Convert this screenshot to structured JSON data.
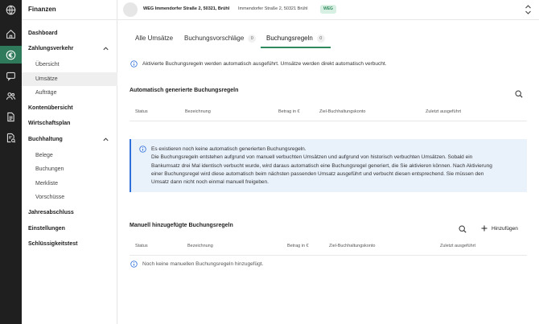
{
  "sidebar": {
    "title": "Finanzen",
    "items": [
      {
        "label": "Dashboard"
      },
      {
        "label": "Zahlungsverkehr"
      },
      {
        "label": "Übersicht"
      },
      {
        "label": "Umsätze"
      },
      {
        "label": "Aufträge"
      },
      {
        "label": "Kontenübersicht"
      },
      {
        "label": "Wirtschaftsplan"
      },
      {
        "label": "Buchhaltung"
      },
      {
        "label": "Belege"
      },
      {
        "label": "Buchungen"
      },
      {
        "label": "Merkliste"
      },
      {
        "label": "Vorschüsse"
      },
      {
        "label": "Jahresabschluss"
      },
      {
        "label": "Einstellungen"
      },
      {
        "label": "Schlüssigkeitstest"
      }
    ]
  },
  "rail_icons": [
    "globe-icon",
    "home-icon",
    "euro-icon",
    "chat-icon",
    "people-icon",
    "document-icon",
    "document-list-icon"
  ],
  "topbar": {
    "property_name": "WEG Immendorfer Straße 2, 50321, Brühl",
    "property_address": "Immendorfer Straße 2, 50321 Brühl",
    "badge": "WEG"
  },
  "tabs": [
    {
      "label": "Alle Umsätze",
      "count": ""
    },
    {
      "label": "Buchungsvorschläge",
      "count": "0"
    },
    {
      "label": "Buchungsregeln",
      "count": "0"
    }
  ],
  "notice": "Aktivierte Buchungsregeln werden automatisch ausgeführt. Umsätze werden direkt automatisch verbucht.",
  "auto_section": {
    "title": "Automatisch generierte Buchungsregeln",
    "columns": [
      "Status",
      "Bezeichnung",
      "Betrag in €",
      "Ziel-Buchhaltungskonto",
      "Zuletzt ausgeführt"
    ],
    "info_lines": [
      "Es existieren noch keine automatisch generierten Buchungsregeln.",
      "Die Buchungsregeln entstehen aufgrund von manuell verbuchten Umsätzen und aufgrund von historisch verbuchten Umsätzen.  Sobald ein",
      "Bankumsatz drei Mal identisch verbucht wurde, wird daraus automatisch eine Buchungsregel generiert, die Sie aktivieren können. Nach Aktivierung",
      "einer Buchungsregel wird diese automatisch beim nächsten passenden Umsatz ausgeführt und verbucht diesen entsprechend. Sie müssen den",
      "Umsatz dann nicht noch einmal manuell freigeben."
    ]
  },
  "manual_section": {
    "title": "Manuell hinzugefügte Buchungsregeln",
    "add_label": "Hinzufügen",
    "columns": [
      "Status",
      "Bezeichnung",
      "Betrag in €",
      "Ziel-Buchhaltungskonto",
      "Zuletzt ausgeführt"
    ],
    "empty_text": "Noch keine manuellen Buchungsregeln hinzugefügt."
  },
  "colors": {
    "accent": "#2f8a5d",
    "rail": "#1f1f1f",
    "info": "#2e6fd8",
    "info_bg": "#e9f1fb"
  }
}
